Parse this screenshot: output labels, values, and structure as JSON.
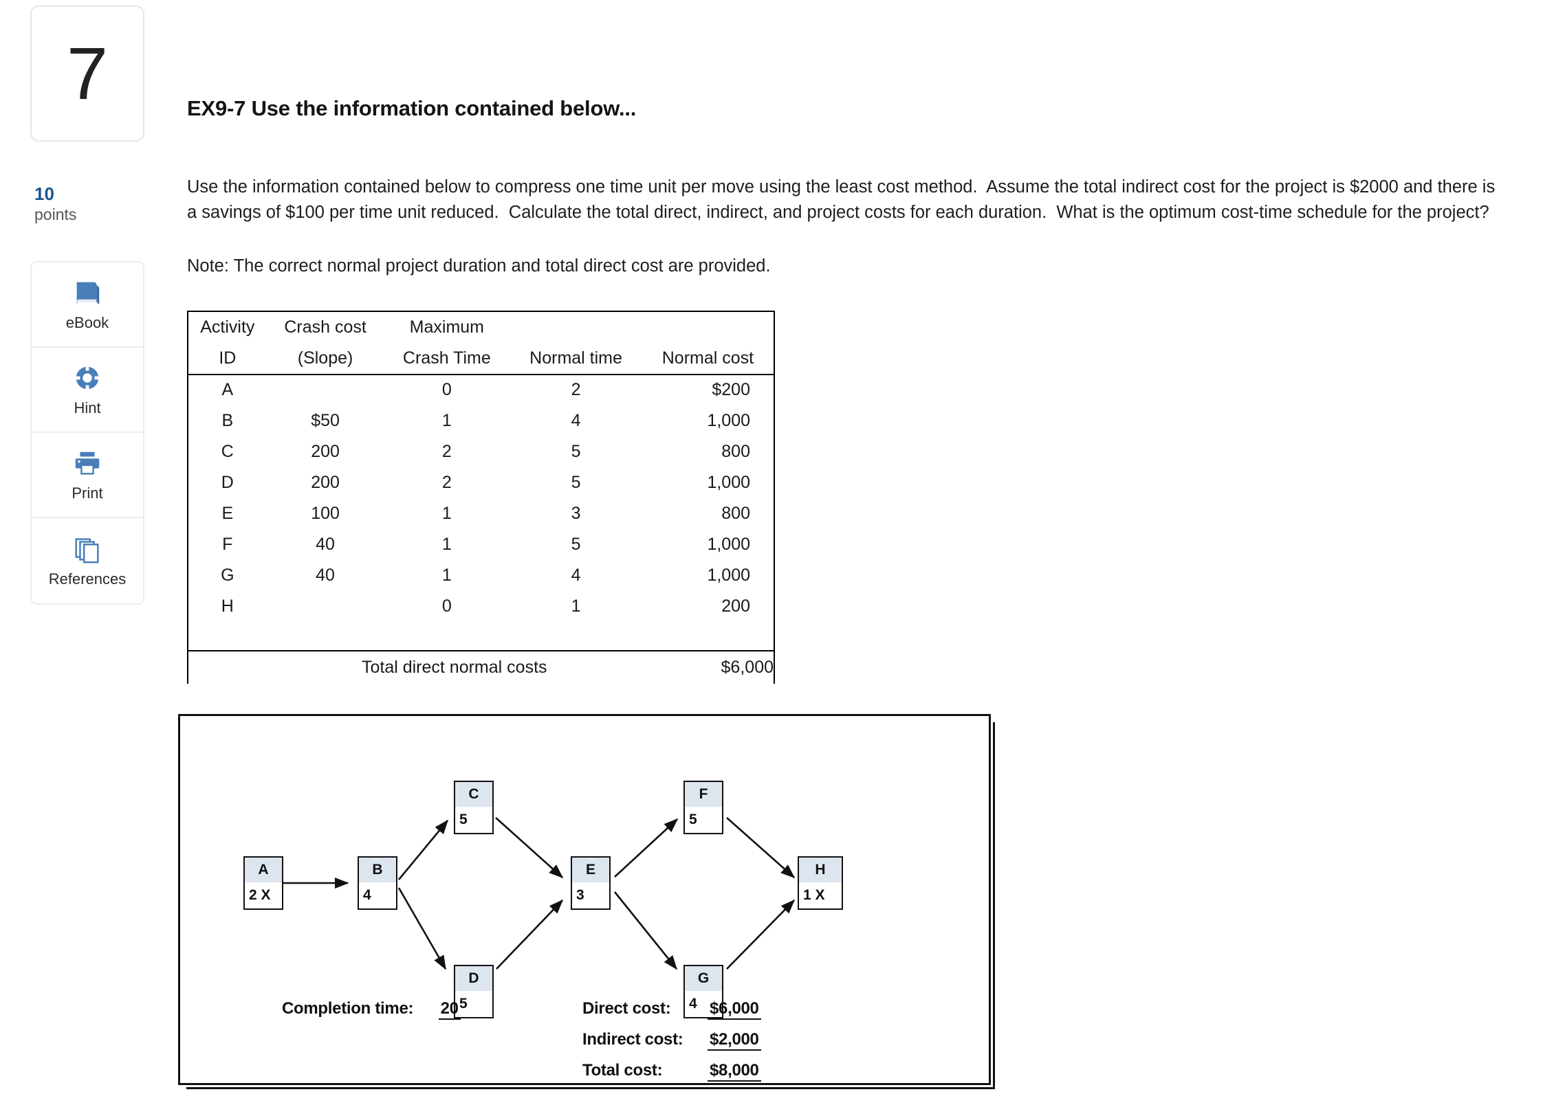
{
  "question": {
    "number": "7",
    "points_value": "10",
    "points_label": "points",
    "title": "EX9-7 Use the information contained below...",
    "body": "Use the information contained below to compress one time unit per move using the least cost method.  Assume the total indirect cost for the project is $2000 and there is a savings of $100 per time unit reduced.  Calculate the total direct, indirect, and project costs for each duration.  What is the optimum cost-time schedule for the project?",
    "note": "Note:  The correct normal project duration and total direct cost are provided."
  },
  "tools": [
    {
      "id": "ebook",
      "label": "eBook",
      "icon": "book-icon"
    },
    {
      "id": "hint",
      "label": "Hint",
      "icon": "life-preserver-icon"
    },
    {
      "id": "print",
      "label": "Print",
      "icon": "printer-icon"
    },
    {
      "id": "references",
      "label": "References",
      "icon": "stacked-pages-icon"
    }
  ],
  "table": {
    "headers_line1": [
      "Activity",
      "Crash cost",
      "Maximum",
      "",
      ""
    ],
    "headers_line2": [
      "ID",
      "(Slope)",
      "Crash Time",
      "Normal time",
      "Normal cost"
    ],
    "rows": [
      {
        "id": "A",
        "crash_cost": "",
        "max_crash_time": "0",
        "normal_time": "2",
        "normal_cost": "$200"
      },
      {
        "id": "B",
        "crash_cost": "$50",
        "max_crash_time": "1",
        "normal_time": "4",
        "normal_cost": "1,000"
      },
      {
        "id": "C",
        "crash_cost": "200",
        "max_crash_time": "2",
        "normal_time": "5",
        "normal_cost": "800"
      },
      {
        "id": "D",
        "crash_cost": "200",
        "max_crash_time": "2",
        "normal_time": "5",
        "normal_cost": "1,000"
      },
      {
        "id": "E",
        "crash_cost": "100",
        "max_crash_time": "1",
        "normal_time": "3",
        "normal_cost": "800"
      },
      {
        "id": "F",
        "crash_cost": "40",
        "max_crash_time": "1",
        "normal_time": "5",
        "normal_cost": "1,000"
      },
      {
        "id": "G",
        "crash_cost": "40",
        "max_crash_time": "1",
        "normal_time": "4",
        "normal_cost": "1,000"
      },
      {
        "id": "H",
        "crash_cost": "",
        "max_crash_time": "0",
        "normal_time": "1",
        "normal_cost": "200"
      }
    ],
    "total_label": "Total direct normal costs",
    "total_value": "$6,000"
  },
  "diagram": {
    "nodes": [
      {
        "id": "A",
        "label": "A",
        "duration": "2 X"
      },
      {
        "id": "B",
        "label": "B",
        "duration": "4"
      },
      {
        "id": "C",
        "label": "C",
        "duration": "5"
      },
      {
        "id": "D",
        "label": "D",
        "duration": "5"
      },
      {
        "id": "E",
        "label": "E",
        "duration": "3"
      },
      {
        "id": "F",
        "label": "F",
        "duration": "5"
      },
      {
        "id": "G",
        "label": "G",
        "duration": "4"
      },
      {
        "id": "H",
        "label": "H",
        "duration": "1 X"
      }
    ],
    "edges": [
      [
        "A",
        "B"
      ],
      [
        "B",
        "C"
      ],
      [
        "B",
        "D"
      ],
      [
        "C",
        "E"
      ],
      [
        "D",
        "E"
      ],
      [
        "E",
        "F"
      ],
      [
        "E",
        "G"
      ],
      [
        "F",
        "H"
      ],
      [
        "G",
        "H"
      ]
    ],
    "summary": {
      "completion_label": "Completion time:",
      "completion_value": "20",
      "direct_label": "Direct cost:",
      "direct_value": "$6,000",
      "indirect_label": "Indirect cost:",
      "indirect_value": "$2,000",
      "total_label": "Total cost:",
      "total_value": "$8,000"
    }
  },
  "colors": {
    "node_header": "#dde5ef",
    "points_accent": "#19548f",
    "icon_blue": "#4a7ebb"
  }
}
